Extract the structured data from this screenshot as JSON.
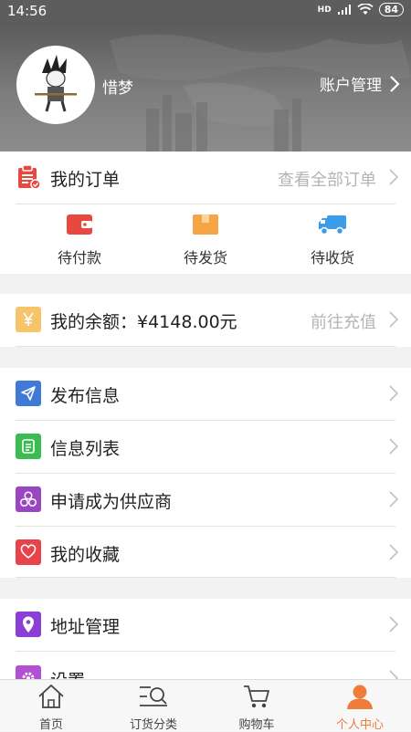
{
  "status_bar": {
    "time": "14:56",
    "network": "HD",
    "battery": "84"
  },
  "profile": {
    "username": "惜梦",
    "account_label": "账户管理"
  },
  "orders": {
    "title": "我的订单",
    "view_all": "查看全部订单",
    "tabs": [
      {
        "label": "待付款",
        "icon": "wallet-icon",
        "color": "#e8483f"
      },
      {
        "label": "待发货",
        "icon": "box-icon",
        "color": "#f5a545"
      },
      {
        "label": "待收货",
        "icon": "truck-icon",
        "color": "#3b9de8"
      }
    ]
  },
  "balance": {
    "label": "我的余额：¥4148.00元",
    "action": "前往充值",
    "icon": "yuan-icon",
    "color": "#f6c46a"
  },
  "menu": [
    {
      "label": "发布信息",
      "icon": "send-icon",
      "color": "#3f7bd6"
    },
    {
      "label": "信息列表",
      "icon": "list-icon",
      "color": "#3cbb52"
    },
    {
      "label": "申请成为供应商",
      "icon": "supplier-icon",
      "color": "#9a46c2"
    },
    {
      "label": "我的收藏",
      "icon": "heart-icon",
      "color": "#e8434b"
    }
  ],
  "menu2": [
    {
      "label": "地址管理",
      "icon": "location-icon",
      "color": "#8b3fd6"
    },
    {
      "label": "设置",
      "icon": "gear-icon",
      "color": "#b24fd2"
    }
  ],
  "tabbar": {
    "items": [
      {
        "label": "首页",
        "icon": "home-icon"
      },
      {
        "label": "订货分类",
        "icon": "category-icon"
      },
      {
        "label": "购物车",
        "icon": "cart-icon"
      },
      {
        "label": "个人中心",
        "icon": "person-icon",
        "active": true
      }
    ],
    "active_color": "#f07c3c"
  }
}
